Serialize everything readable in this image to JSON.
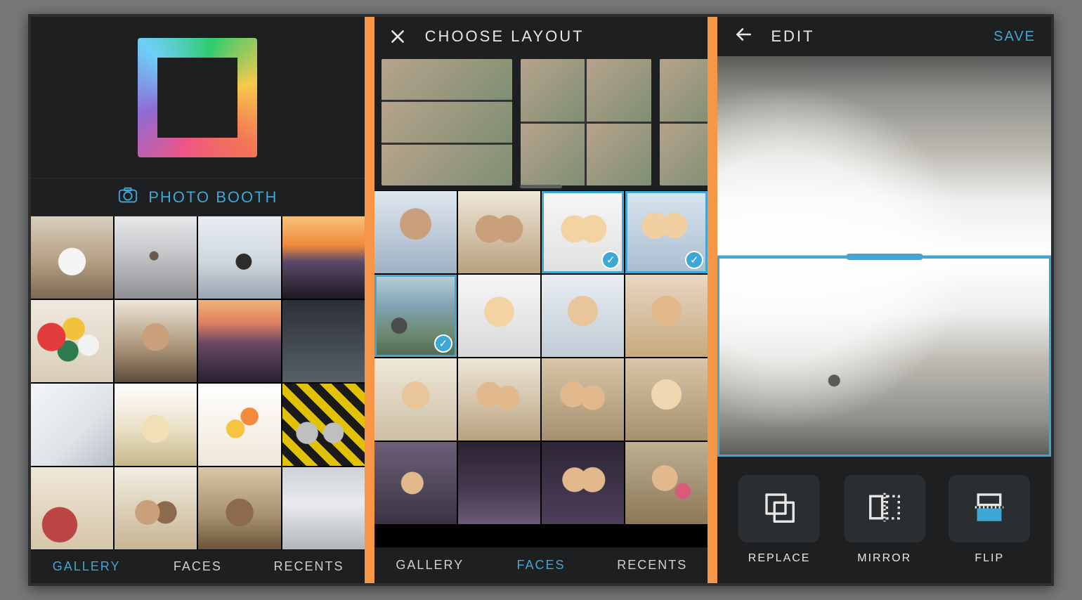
{
  "accent": "#3ea7d6",
  "panel1": {
    "photo_booth_label": "PHOTO BOOTH",
    "tabs": [
      {
        "id": "gallery",
        "label": "GALLERY",
        "active": true
      },
      {
        "id": "faces",
        "label": "FACES",
        "active": false
      },
      {
        "id": "recents",
        "label": "RECENTS",
        "active": false
      }
    ],
    "gallery_thumbs": [
      "dog",
      "hiker-rock",
      "seated-woman",
      "sunset-silhouette",
      "balloons",
      "curly-smile",
      "sunset-palm",
      "dark-window",
      "kid-doorway",
      "pastries",
      "flowers",
      "bike-leaves",
      "red-plate",
      "two-puppies",
      "puppy",
      "misc"
    ]
  },
  "panel2": {
    "title": "CHOOSE LAYOUT",
    "close_icon": "close-icon",
    "layout_templates": [
      {
        "id": "layout-3row",
        "rows": 3,
        "cols": 1
      },
      {
        "id": "layout-2x2",
        "rows": 2,
        "cols": 2
      },
      {
        "id": "layout-1v2",
        "rows": 2,
        "cols": 2,
        "partial": true
      }
    ],
    "faces_thumbs": [
      {
        "id": "hat-girl",
        "selected": false
      },
      {
        "id": "two-curly",
        "selected": false
      },
      {
        "id": "couple-light",
        "selected": true
      },
      {
        "id": "car-selfie",
        "selected": true
      },
      {
        "id": "beach-group",
        "selected": true
      },
      {
        "id": "blonde",
        "selected": false
      },
      {
        "id": "beach-girl",
        "selected": false
      },
      {
        "id": "brunette-warm",
        "selected": false
      },
      {
        "id": "sunglasses",
        "selected": false
      },
      {
        "id": "funny-faces",
        "selected": false
      },
      {
        "id": "couple-2",
        "selected": false
      },
      {
        "id": "glasses-guy",
        "selected": false
      },
      {
        "id": "phone-selfie",
        "selected": false
      },
      {
        "id": "night-1",
        "selected": false
      },
      {
        "id": "night-2",
        "selected": false
      },
      {
        "id": "baby-hold",
        "selected": false
      }
    ],
    "tabs": [
      {
        "id": "gallery",
        "label": "GALLERY",
        "active": false
      },
      {
        "id": "faces",
        "label": "FACES",
        "active": true
      },
      {
        "id": "recents",
        "label": "RECENTS",
        "active": false
      }
    ]
  },
  "panel3": {
    "back_icon": "back-arrow-icon",
    "title": "EDIT",
    "save_label": "SAVE",
    "canvas": {
      "split": "horizontal",
      "panes": [
        {
          "id": "top",
          "image": "mountain-flipped",
          "selected": false
        },
        {
          "id": "bottom",
          "image": "mountain-jump",
          "selected": true
        }
      ]
    },
    "actions": [
      {
        "id": "replace",
        "label": "REPLACE",
        "icon": "replace-icon"
      },
      {
        "id": "mirror",
        "label": "MIRROR",
        "icon": "mirror-icon"
      },
      {
        "id": "flip",
        "label": "FLIP",
        "icon": "flip-icon"
      }
    ]
  }
}
